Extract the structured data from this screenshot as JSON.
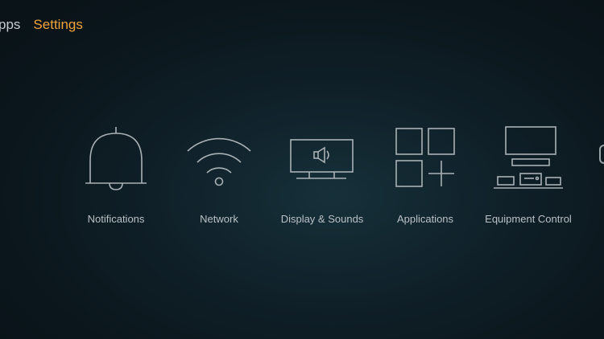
{
  "nav": {
    "items": [
      {
        "label": "pps",
        "active": false
      },
      {
        "label": "Settings",
        "active": true
      }
    ],
    "active_color": "#f0a43c"
  },
  "tiles": [
    {
      "label": "Notifications",
      "icon": "bell-icon"
    },
    {
      "label": "Network",
      "icon": "wifi-icon"
    },
    {
      "label": "Display & Sounds",
      "icon": "tv-speaker-icon"
    },
    {
      "label": "Applications",
      "icon": "apps-grid-icon"
    },
    {
      "label": "Equipment Control",
      "icon": "equipment-icon"
    }
  ],
  "colors": {
    "icon_stroke": "#a9b1b5",
    "label_text": "#b9c1c5"
  }
}
